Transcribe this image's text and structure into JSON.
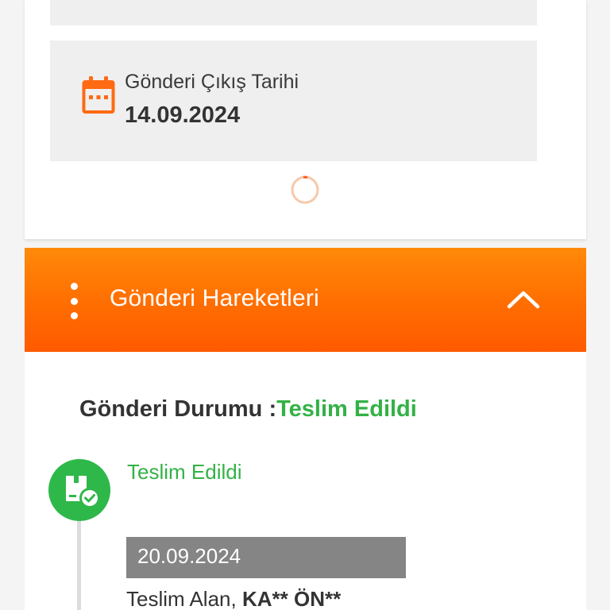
{
  "shipment_info": {
    "departure_label": "Gönderi Çıkış Tarihi",
    "departure_date": "14.09.2024",
    "icon": "calendar-icon"
  },
  "movements_section": {
    "title": "Gönderi Hareketleri",
    "menu_icon": "kebab-menu-icon",
    "toggle_icon": "chevron-up-icon"
  },
  "status": {
    "label": "Gönderi Durumu :",
    "value": "Teslim Edildi"
  },
  "timeline": [
    {
      "title": "Teslim Edildi",
      "date": "20.09.2024",
      "receiver_label": "Teslim Alan, ",
      "receiver_name": "KA** ÖN**",
      "icon": "package-delivered-icon"
    }
  ],
  "colors": {
    "accent_orange": "#ff6d00",
    "success_green": "#33b246",
    "date_box_gray": "#858585"
  }
}
